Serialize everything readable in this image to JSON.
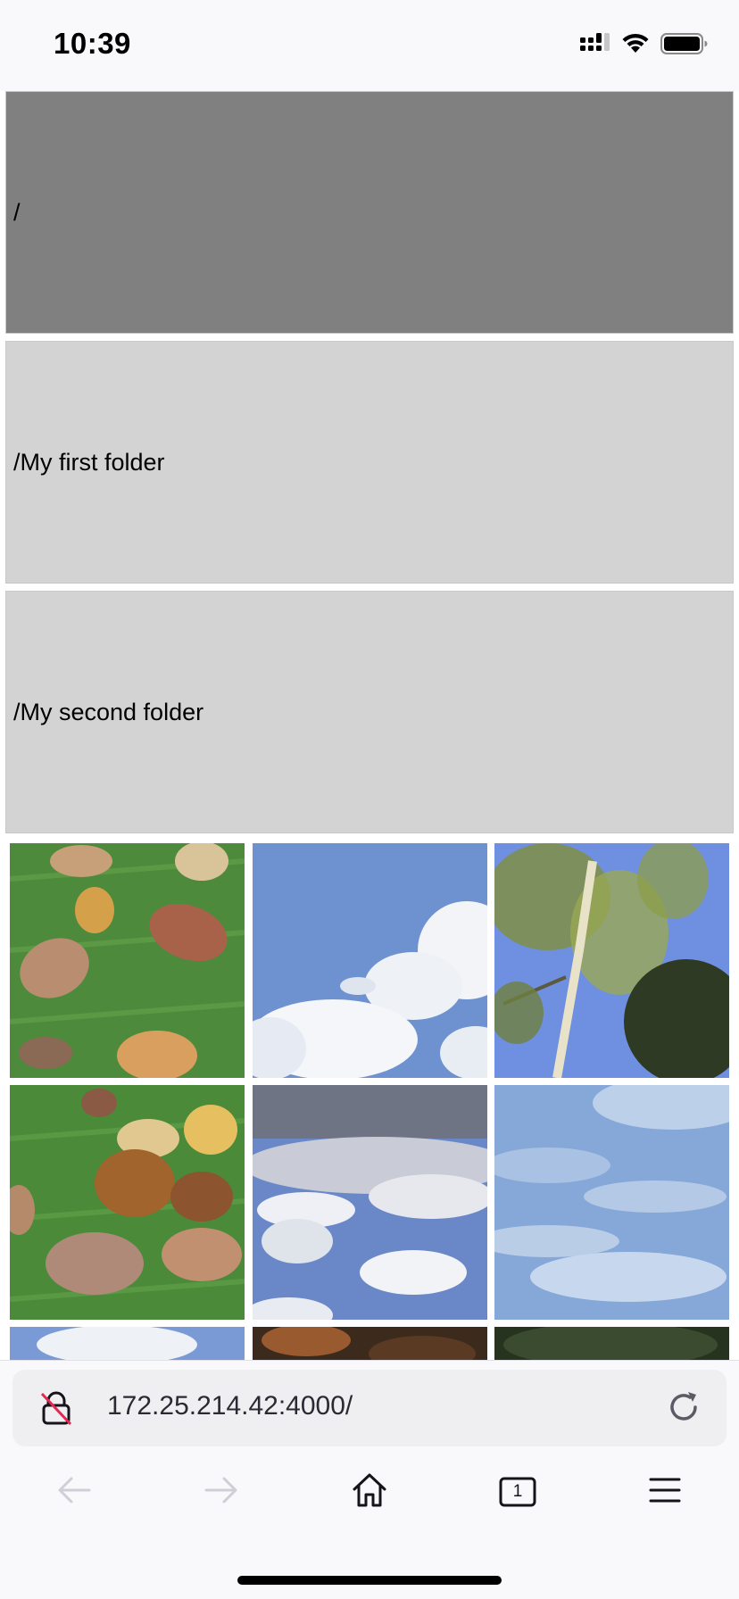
{
  "status_bar": {
    "time": "10:39",
    "icons": [
      "cellular-signal-icon",
      "wifi-icon",
      "battery-icon"
    ]
  },
  "folders": [
    {
      "label": "/",
      "current": true
    },
    {
      "label": "/My first folder",
      "current": false
    },
    {
      "label": "/My second folder",
      "current": false
    }
  ],
  "photos": [
    {
      "subject": "autumn-leaves-on-grass"
    },
    {
      "subject": "blue-sky-with-clouds"
    },
    {
      "subject": "birch-tree-against-sky"
    },
    {
      "subject": "autumn-leaves-on-grass"
    },
    {
      "subject": "grey-and-white-clouds"
    },
    {
      "subject": "pale-blue-sky-clouds"
    },
    {
      "subject": "sky-with-clouds"
    },
    {
      "subject": "brown-leaves"
    },
    {
      "subject": "dark-trees"
    }
  ],
  "browser": {
    "url": "172.25.214.42:4000/",
    "tab_count": "1",
    "icons": [
      "insecure-lock-icon",
      "reload-icon",
      "back-arrow-icon",
      "forward-arrow-icon",
      "home-icon",
      "tabs-icon",
      "menu-icon"
    ]
  },
  "colors": {
    "current_folder_bg": "#808080",
    "folder_bg": "#d3d3d3",
    "toolbar_bg": "#f9f9fb",
    "url_field_bg": "#efeff2"
  }
}
